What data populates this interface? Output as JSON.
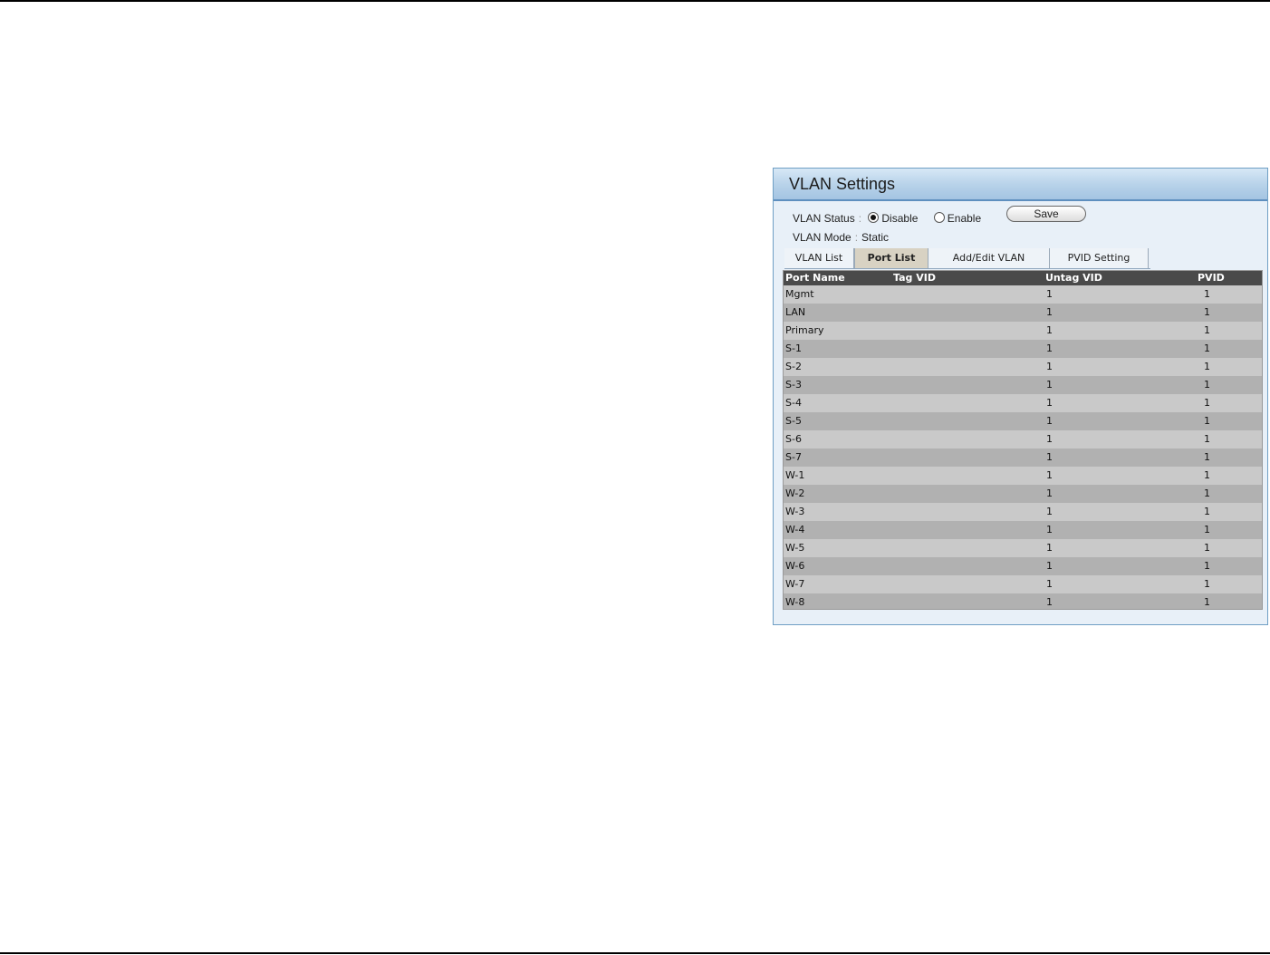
{
  "panel": {
    "title": "VLAN Settings",
    "vlan_status": {
      "label": "VLAN Status",
      "options": [
        {
          "label": "Disable",
          "checked": true
        },
        {
          "label": "Enable",
          "checked": false
        }
      ],
      "save_label": "Save"
    },
    "vlan_mode": {
      "label": "VLAN Mode",
      "value": "Static"
    },
    "separator": ":",
    "tabs": [
      {
        "label": "VLAN List",
        "active": false
      },
      {
        "label": "Port List",
        "active": true
      },
      {
        "label": "Add/Edit VLAN",
        "active": false
      },
      {
        "label": "PVID Setting",
        "active": false
      }
    ],
    "table": {
      "columns": [
        "Port Name",
        "Tag VID",
        "Untag VID",
        "PVID"
      ],
      "rows": [
        {
          "name": "Mgmt",
          "tag": "",
          "untag": "1",
          "pvid": "1"
        },
        {
          "name": "LAN",
          "tag": "",
          "untag": "1",
          "pvid": "1"
        },
        {
          "name": "Primary",
          "tag": "",
          "untag": "1",
          "pvid": "1"
        },
        {
          "name": "S-1",
          "tag": "",
          "untag": "1",
          "pvid": "1"
        },
        {
          "name": "S-2",
          "tag": "",
          "untag": "1",
          "pvid": "1"
        },
        {
          "name": "S-3",
          "tag": "",
          "untag": "1",
          "pvid": "1"
        },
        {
          "name": "S-4",
          "tag": "",
          "untag": "1",
          "pvid": "1"
        },
        {
          "name": "S-5",
          "tag": "",
          "untag": "1",
          "pvid": "1"
        },
        {
          "name": "S-6",
          "tag": "",
          "untag": "1",
          "pvid": "1"
        },
        {
          "name": "S-7",
          "tag": "",
          "untag": "1",
          "pvid": "1"
        },
        {
          "name": "W-1",
          "tag": "",
          "untag": "1",
          "pvid": "1"
        },
        {
          "name": "W-2",
          "tag": "",
          "untag": "1",
          "pvid": "1"
        },
        {
          "name": "W-3",
          "tag": "",
          "untag": "1",
          "pvid": "1"
        },
        {
          "name": "W-4",
          "tag": "",
          "untag": "1",
          "pvid": "1"
        },
        {
          "name": "W-5",
          "tag": "",
          "untag": "1",
          "pvid": "1"
        },
        {
          "name": "W-6",
          "tag": "",
          "untag": "1",
          "pvid": "1"
        },
        {
          "name": "W-7",
          "tag": "",
          "untag": "1",
          "pvid": "1"
        },
        {
          "name": "W-8",
          "tag": "",
          "untag": "1",
          "pvid": "1"
        }
      ]
    }
  },
  "colors": {
    "header_blue": "#a4c4e2",
    "panel_bg": "#e8f0f8",
    "table_header": "#4a4a4a",
    "row_light": "#c9c9c9",
    "row_dark": "#b1b1b1"
  }
}
